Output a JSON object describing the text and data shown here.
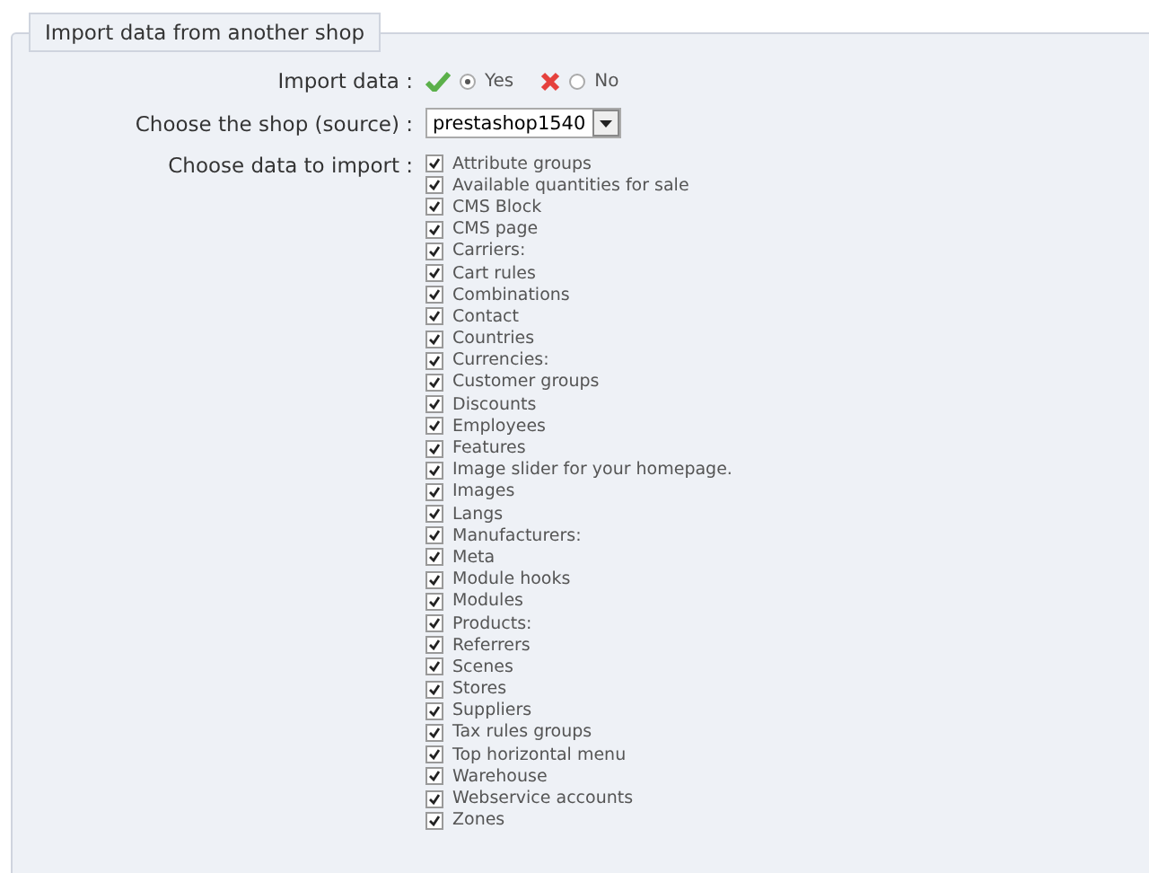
{
  "section": {
    "title": "Import data from another shop"
  },
  "import_data": {
    "label": "Import data :",
    "options": [
      {
        "label": "Yes",
        "selected": true
      },
      {
        "label": "No",
        "selected": false
      }
    ]
  },
  "shop": {
    "label": "Choose the shop (source) :",
    "value": "prestashop1540"
  },
  "data_to_import": {
    "label": "Choose data to import :",
    "items": [
      {
        "label": "Attribute groups",
        "checked": true
      },
      {
        "label": "Available quantities for sale",
        "checked": true
      },
      {
        "label": "CMS Block",
        "checked": true
      },
      {
        "label": "CMS page",
        "checked": true
      },
      {
        "label": "Carriers:",
        "checked": true
      },
      {
        "label": "Cart rules",
        "checked": true
      },
      {
        "label": "Combinations",
        "checked": true
      },
      {
        "label": "Contact",
        "checked": true
      },
      {
        "label": "Countries",
        "checked": true
      },
      {
        "label": "Currencies:",
        "checked": true
      },
      {
        "label": "Customer groups",
        "checked": true
      },
      {
        "label": "Discounts",
        "checked": true
      },
      {
        "label": "Employees",
        "checked": true
      },
      {
        "label": "Features",
        "checked": true
      },
      {
        "label": "Image slider for your homepage.",
        "checked": true
      },
      {
        "label": "Images",
        "checked": true
      },
      {
        "label": "Langs",
        "checked": true
      },
      {
        "label": "Manufacturers:",
        "checked": true
      },
      {
        "label": "Meta",
        "checked": true
      },
      {
        "label": "Module hooks",
        "checked": true
      },
      {
        "label": "Modules",
        "checked": true
      },
      {
        "label": "Products:",
        "checked": true
      },
      {
        "label": "Referrers",
        "checked": true
      },
      {
        "label": "Scenes",
        "checked": true
      },
      {
        "label": "Stores",
        "checked": true
      },
      {
        "label": "Suppliers",
        "checked": true
      },
      {
        "label": "Tax rules groups",
        "checked": true
      },
      {
        "label": "Top horizontal menu",
        "checked": true
      },
      {
        "label": "Warehouse",
        "checked": true
      },
      {
        "label": "Webservice accounts",
        "checked": true
      },
      {
        "label": "Zones",
        "checked": true
      }
    ]
  }
}
